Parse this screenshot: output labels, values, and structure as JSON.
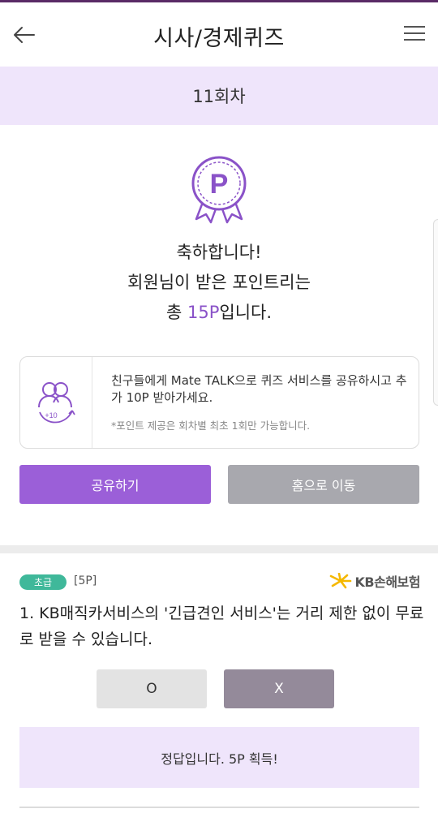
{
  "header": {
    "title": "시사/경제퀴즈",
    "back_icon": "arrow-left-icon",
    "menu_icon": "hamburger-menu-icon"
  },
  "round": {
    "label": "11회차"
  },
  "result_summary": {
    "badge_icon": "point-medal-icon",
    "line1": "축하합니다!",
    "line2": "회원님이 받은 포인트리는",
    "line3_prefix": "총 ",
    "line3_points": "15P",
    "line3_suffix": "입니다."
  },
  "share_box": {
    "icon": "friends-plus10-icon",
    "icon_badge": "+10",
    "text": "친구들에게 Mate TALK으로 퀴즈 서비스를 공유하시고 추가 10P 받아가세요.",
    "note": "*포인트 제공은 회차별 최초 1회만 가능합니다."
  },
  "buttons": {
    "share_label": "공유하기",
    "home_label": "홈으로 이동"
  },
  "question": {
    "level": "초급",
    "points": "[5P]",
    "sponsor": "KB손해보험",
    "sponsor_icon": "kb-star-logo-icon",
    "text": "1. KB매직카서비스의 '긴급견인 서비스'는 거리 제한 없이 무료로 받을 수 있습니다.",
    "option_o": "O",
    "option_x": "X",
    "selected": "X",
    "result_text": "정답입니다. 5P 획득!"
  },
  "colors": {
    "accent_purple": "#9b5fd8",
    "light_purple": "#efe5fb",
    "level_green": "#3fb89a",
    "kb_yellow": "#f5b800"
  }
}
